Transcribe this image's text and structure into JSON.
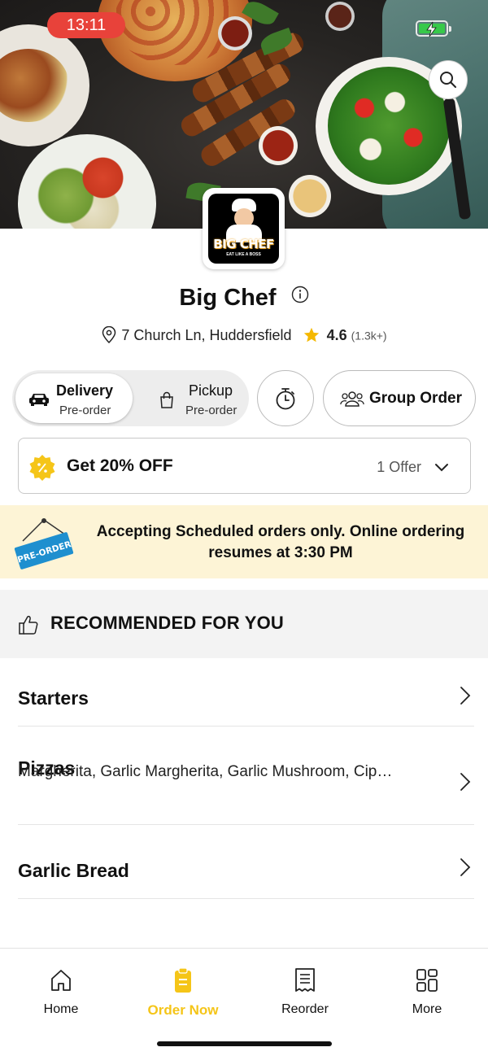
{
  "status_bar": {
    "time": "13:11"
  },
  "restaurant": {
    "name": "Big Chef",
    "logo_text": "BIG CHEF",
    "logo_tagline": "EAT LIKE A BOSS",
    "address": "7 Church Ln, Huddersfield",
    "rating": "4.6",
    "rating_count": "(1.3k+)"
  },
  "order_modes": {
    "delivery": {
      "label": "Delivery",
      "sub": "Pre-order",
      "selected": true
    },
    "pickup": {
      "label": "Pickup",
      "sub": "Pre-order",
      "selected": false
    }
  },
  "group_order_label": "Group Order",
  "offer": {
    "title": "Get 20% OFF",
    "count": "1 Offer"
  },
  "notice": {
    "tag": "PRE-ORDER",
    "message": "Accepting Scheduled orders only. Online ordering resumes at 3:30 PM"
  },
  "recommended": {
    "label": "RECOMMENDED FOR YOU"
  },
  "categories": [
    {
      "name": "Starters",
      "items": ""
    },
    {
      "name": "Pizzas",
      "items": "Margherita, Garlic Margherita, Garlic Mushroom, Cip…"
    },
    {
      "name": "Garlic Bread",
      "items": ""
    }
  ],
  "bottom_nav": [
    {
      "label": "Home",
      "icon": "home-icon",
      "active": false
    },
    {
      "label": "Order Now",
      "icon": "order-icon",
      "active": true
    },
    {
      "label": "Reorder",
      "icon": "receipt-icon",
      "active": false
    },
    {
      "label": "More",
      "icon": "grid-icon",
      "active": false
    }
  ],
  "colors": {
    "accent": "#f5c518",
    "status_time_bg": "#e8423a",
    "notice_bg": "#fdf4d6",
    "preorder_tag": "#1e8fcf",
    "star": "#f5b800"
  }
}
